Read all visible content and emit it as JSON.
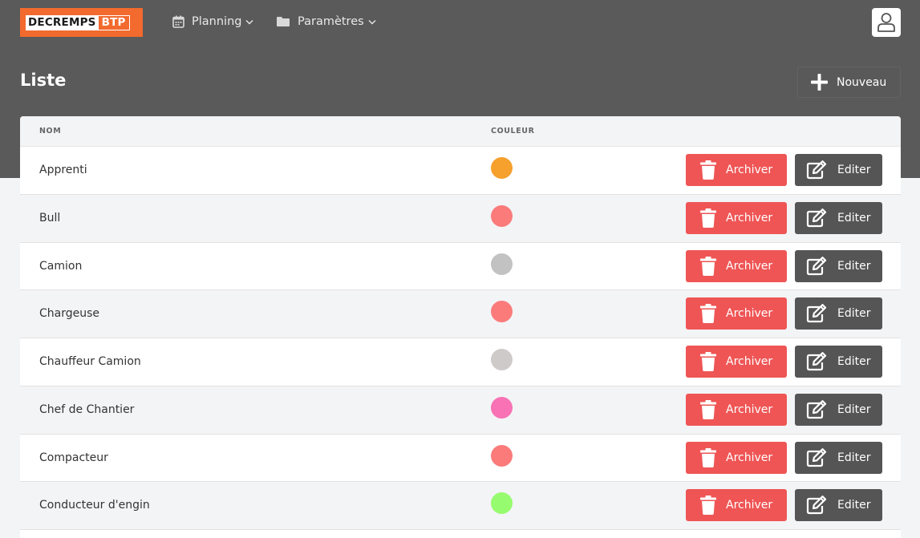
{
  "brand": {
    "part1": "DECREMPS",
    "part2": "BTP",
    "color": "#f26a2e"
  },
  "nav": [
    {
      "label": "Planning",
      "icon": "calendar-icon"
    },
    {
      "label": "Paramètres",
      "icon": "folder-icon"
    }
  ],
  "user": {
    "icon": "user-icon"
  },
  "page": {
    "title": "Liste",
    "new_label": "Nouveau"
  },
  "table": {
    "headers": {
      "nom": "NOM",
      "couleur": "COULEUR"
    },
    "archive_label": "Archiver",
    "edit_label": "Editer",
    "rows": [
      {
        "name": "Apprenti",
        "color": "#f6a02d"
      },
      {
        "name": "Bull",
        "color": "#fb7b7b"
      },
      {
        "name": "Camion",
        "color": "#c2c2c2"
      },
      {
        "name": "Chargeuse",
        "color": "#fb7b7b"
      },
      {
        "name": "Chauffeur Camion",
        "color": "#cfcaca"
      },
      {
        "name": "Chef de Chantier",
        "color": "#f872b5"
      },
      {
        "name": "Compacteur",
        "color": "#fb7b7b"
      },
      {
        "name": "Conducteur d'engin",
        "color": "#96fb6e"
      }
    ]
  },
  "colors": {
    "archive": "#ef5555",
    "edit": "#555555",
    "header_bg": "#5a5a5a"
  }
}
